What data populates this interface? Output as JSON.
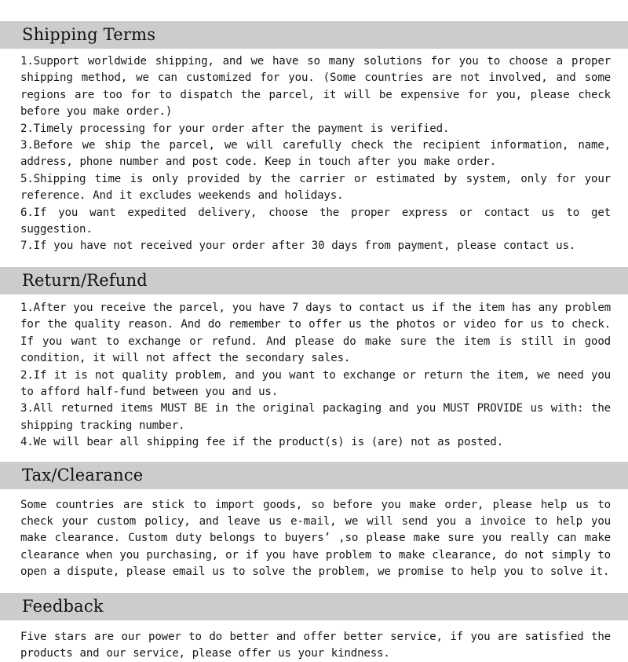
{
  "document": {
    "background_color": "#ffffff",
    "heading_band_color": "#cccccc",
    "text_color": "#161616"
  },
  "sections": [
    {
      "id": "shipping-terms",
      "heading": "Shipping Terms",
      "body": "1.Support worldwide shipping, and we have so many solutions for you to choose a proper shipping method, we can customized for you. (Some countries are not involved, and some regions are too for to dispatch the parcel, it will be expensive for you, please check before you make order.)\n2.Timely processing for your order after the payment is verified.\n3.Before we ship the parcel, we will carefully check the recipient information, name, address, phone number and post code. Keep in touch after you make order.\n5.Shipping time is only provided by the carrier or estimated by system, only for your reference. And it excludes weekends and holidays.\n6.If you want expedited delivery, choose the proper express or contact us to get suggestion.\n7.If you have not received your order after 30 days from payment, please contact us."
    },
    {
      "id": "return-refund",
      "heading": "Return/Refund",
      "body": "1.After you receive the parcel, you have 7 days to contact us if the item has any problem for the quality reason. And do remember to offer us the photos or video for us to check. If you want to exchange or refund. And please do make sure the item is still in good condition, it will not affect the secondary sales.\n2.If it is not quality problem, and you want to exchange or return the item, we need you to afford half-fund between you and us.\n3.All returned items MUST BE in the original packaging and you MUST PROVIDE us with: the shipping tracking number.\n4.We will bear all shipping fee if the product(s) is (are) not as posted."
    },
    {
      "id": "tax-clearance",
      "heading": "Tax/Clearance",
      "body": "Some countries are stick to import goods, so before you make order, please help us to check your custom policy, and leave us e-mail, we will send you a invoice to help you make clearance. Custom duty belongs to buyers’ ,so please make sure you really can make clearance when you purchasing, or if you have problem to make clearance, do not simply to open a dispute, please email us to solve the problem, we promise to help you to solve it."
    },
    {
      "id": "feedback",
      "heading": "Feedback",
      "body": "Five stars are our power to do better and offer better service, if you are satisfied the products and our service, please offer us your kindness."
    }
  ]
}
